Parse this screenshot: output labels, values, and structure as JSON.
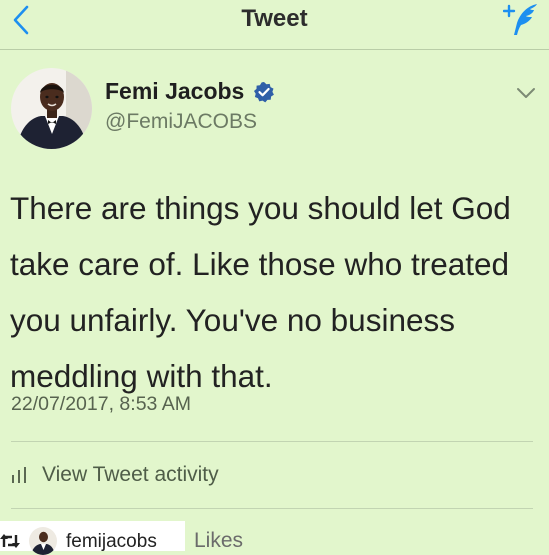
{
  "nav": {
    "title": "Tweet",
    "back_icon": "chevron-left-icon",
    "compose_icon": "compose-quill-icon"
  },
  "tweet": {
    "author": {
      "display_name": "Femi Jacobs",
      "handle": "@FemiJACOBS",
      "verified": true
    },
    "text_lines": [
      "There are things you should let God",
      "take care of. Like those who treated",
      "you unfairly. You've no business",
      "meddling with that."
    ],
    "timestamp": "22/07/2017, 8:53 AM",
    "activity_label": "View Tweet activity"
  },
  "repost": {
    "username": "femijacobs",
    "likes_label": "Likes"
  },
  "colors": {
    "background": "#e2f6cc",
    "accent": "#1d8ff0",
    "verified_badge": "#2f5fa8"
  }
}
